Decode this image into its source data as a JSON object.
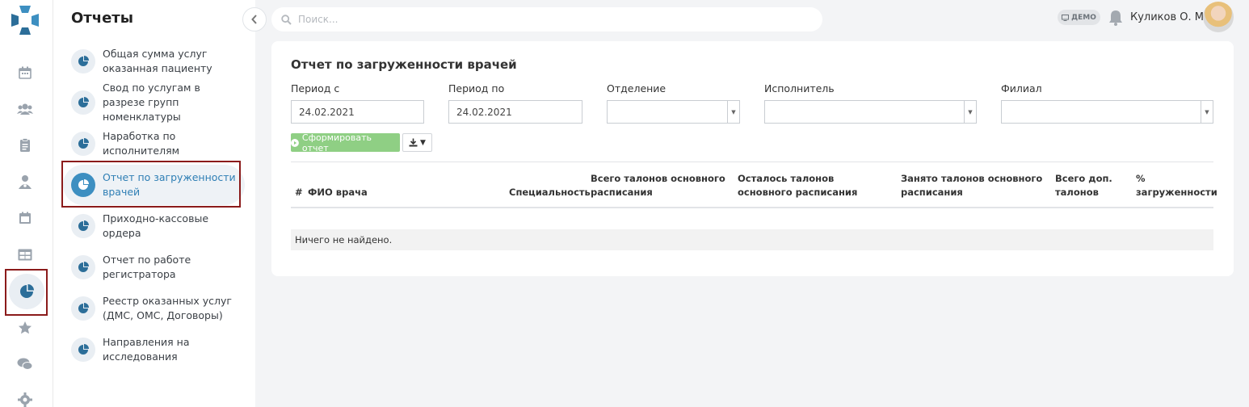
{
  "rail": {
    "icons": [
      "calendar-icon",
      "users-icon",
      "clipboard-icon",
      "doctor-icon",
      "schedule-icon",
      "table-icon",
      "pie-chart-icon",
      "star-icon",
      "chat-icon",
      "settings-icon"
    ]
  },
  "sidebar": {
    "title": "Отчеты",
    "items": [
      {
        "label": "Общая сумма услуг оказанная пациенту"
      },
      {
        "label": "Свод по услугам в разрезе групп номенклатуры"
      },
      {
        "label": "Наработка по исполнителям"
      },
      {
        "label": "Отчет по загруженности врачей"
      },
      {
        "label": "Приходно-кассовые ордера"
      },
      {
        "label": "Отчет по работе регистратора"
      },
      {
        "label": "Реестр оказанных услуг (ДМС, ОМС, Договоры)"
      },
      {
        "label": "Направления на исследования"
      }
    ],
    "active_index": 3
  },
  "header": {
    "search_placeholder": "Поиск...",
    "demo_badge": "ДЕМО",
    "user_name": "Куликов О. М."
  },
  "report": {
    "title": "Отчет по загруженности врачей",
    "filters": {
      "period_from_label": "Период с",
      "period_from_value": "24.02.2021",
      "period_to_label": "Период по",
      "period_to_value": "24.02.2021",
      "department_label": "Отделение",
      "executor_label": "Исполнитель",
      "branch_label": "Филиал"
    },
    "generate_button": "Сформировать отчет",
    "table": {
      "columns": [
        "#",
        "ФИО врача",
        "Специальность",
        "Всего талонов основного расписания",
        "Осталось талонов основного расписания",
        "Занято талонов основного расписания",
        "Всего доп. талонов",
        "% загруженности"
      ],
      "empty_text": "Ничего не найдено."
    }
  },
  "colors": {
    "accent": "#3d8fc1",
    "highlight_box": "#8b1b1b",
    "generate_button": "#8fcf84"
  }
}
